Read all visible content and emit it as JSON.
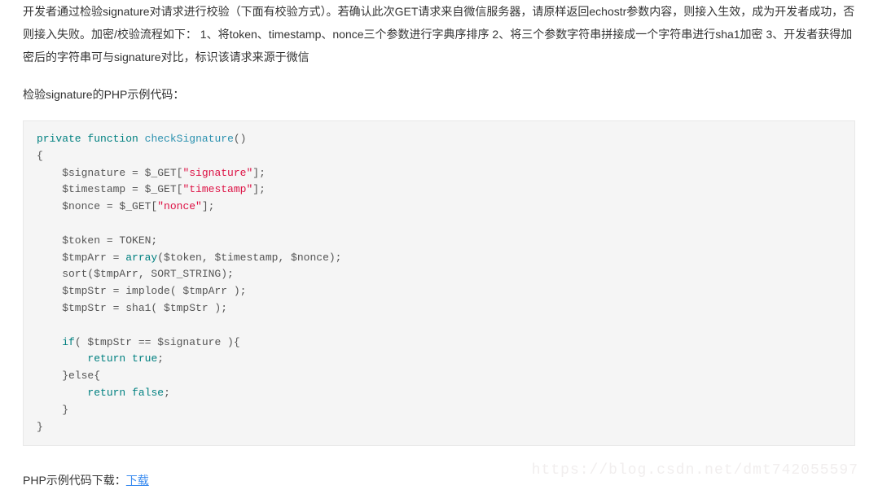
{
  "intro_paragraph": "开发者通过检验signature对请求进行校验（下面有校验方式）。若确认此次GET请求来自微信服务器，请原样返回echostr参数内容，则接入生效，成为开发者成功，否则接入失败。加密/校验流程如下： 1、将token、timestamp、nonce三个参数进行字典序排序 2、将三个参数字符串拼接成一个字符串进行sha1加密 3、开发者获得加密后的字符串可与signature对比，标识该请求来源于微信",
  "example_title": "检验signature的PHP示例代码：",
  "code": {
    "l1_kw1": "private",
    "l1_kw2": "function",
    "l1_fn": "checkSignature",
    "l1_paren": "()",
    "l2_brace": "{",
    "l3_lhs": "    $signature = $_GET[",
    "l3_str": "\"signature\"",
    "l3_tail": "];",
    "l4_lhs": "    $timestamp = $_GET[",
    "l4_str": "\"timestamp\"",
    "l4_tail": "];",
    "l5_lhs": "    $nonce = $_GET[",
    "l5_str": "\"nonce\"",
    "l5_tail": "];",
    "l6_blank": "",
    "l7": "    $token = TOKEN;",
    "l8_lhs": "    $tmpArr = ",
    "l8_kw": "array",
    "l8_args": "($token, $timestamp, $nonce);",
    "l9": "    sort($tmpArr, SORT_STRING);",
    "l10": "    $tmpStr = implode( $tmpArr );",
    "l11": "    $tmpStr = sha1( $tmpStr );",
    "l12_blank": "",
    "l13_if": "    if",
    "l13_cond": "( $tmpStr == $signature ){",
    "l14_indent": "        ",
    "l14_kw": "return",
    "l14_sp": " ",
    "l14_bool": "true",
    "l14_semi": ";",
    "l15_else": "    }else{",
    "l16_indent": "        ",
    "l16_kw": "return",
    "l16_sp": " ",
    "l16_bool": "false",
    "l16_semi": ";",
    "l17_cb": "    }",
    "l18_cb": "}"
  },
  "download_prefix": "PHP示例代码下载：",
  "download_label": "下载",
  "watermark": "https://blog.csdn.net/dmt742055597"
}
